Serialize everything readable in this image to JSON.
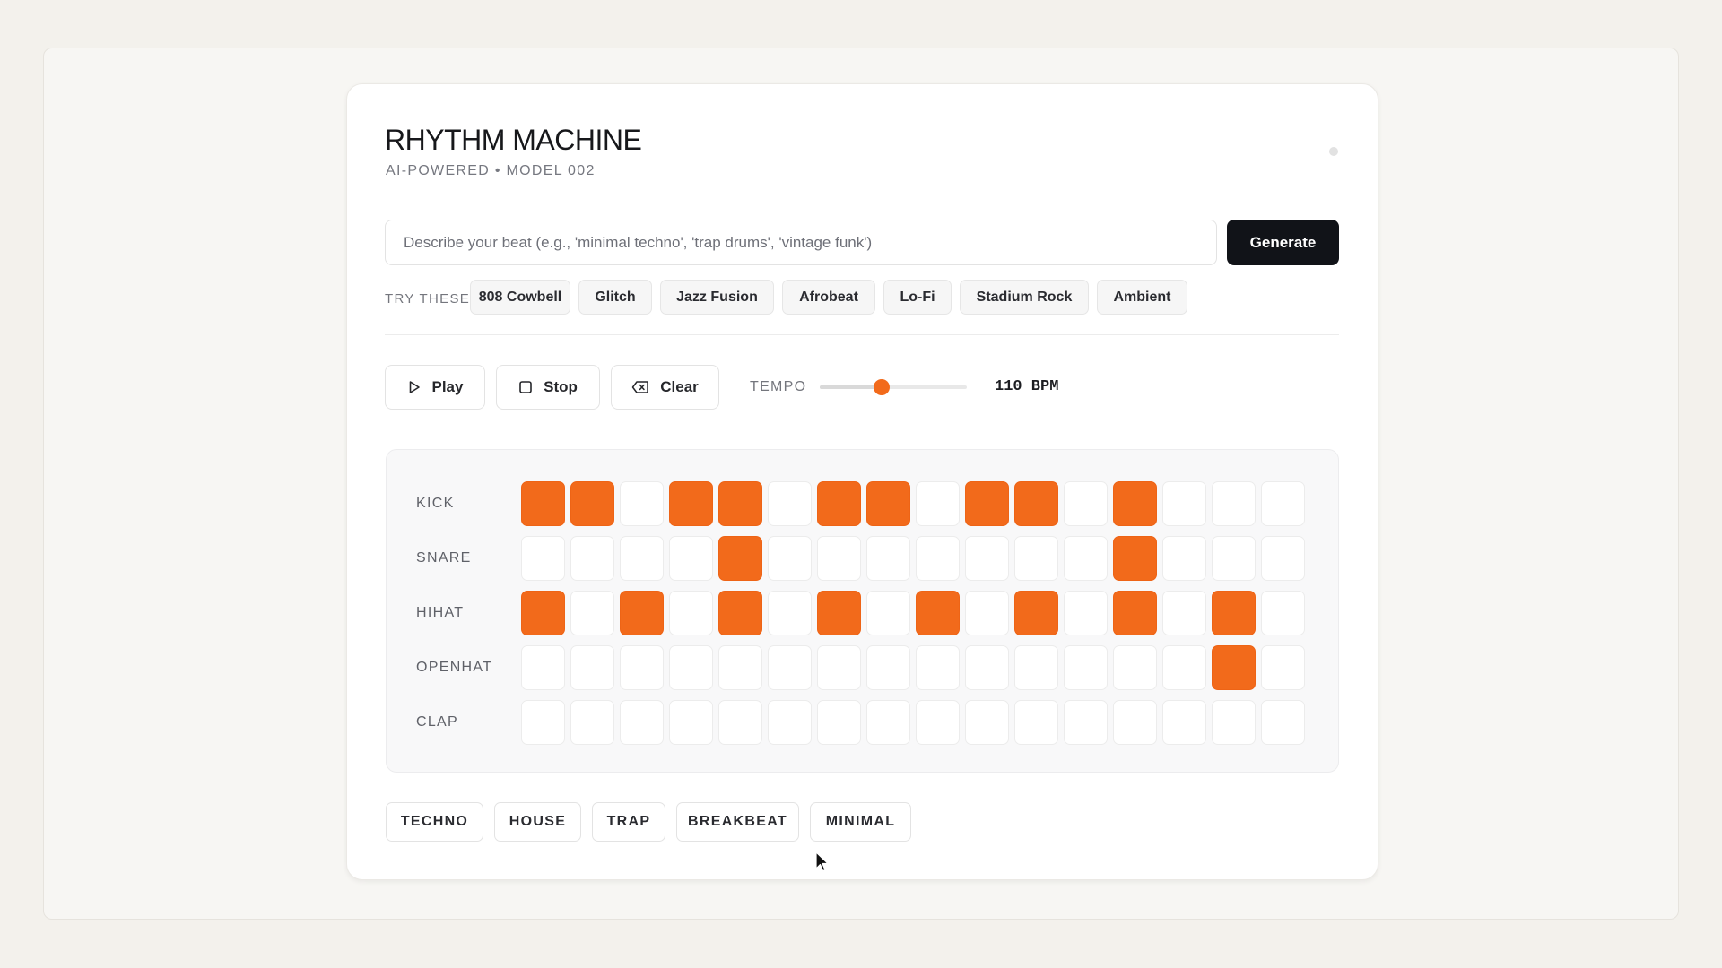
{
  "app": {
    "title": "RHYTHM MACHINE",
    "subtitle": "AI-POWERED • MODEL 002"
  },
  "prompt": {
    "placeholder": "Describe your beat (e.g., 'minimal techno', 'trap drums', 'vintage funk')",
    "value": "",
    "generate_label": "Generate"
  },
  "suggestions": {
    "label": "TRY THESE:",
    "items": [
      "808 Cowbell",
      "Glitch",
      "Jazz Fusion",
      "Afrobeat",
      "Lo-Fi",
      "Stadium Rock",
      "Ambient"
    ]
  },
  "controls": {
    "play_label": "Play",
    "stop_label": "Stop",
    "clear_label": "Clear",
    "tempo_label": "TEMPO",
    "tempo_value": "110 BPM",
    "tempo_fraction": 0.42
  },
  "sequencer": {
    "tracks": [
      {
        "name": "KICK",
        "steps": [
          1,
          1,
          0,
          1,
          1,
          0,
          1,
          1,
          0,
          1,
          1,
          0,
          1,
          0,
          0,
          0
        ]
      },
      {
        "name": "SNARE",
        "steps": [
          0,
          0,
          0,
          0,
          1,
          0,
          0,
          0,
          0,
          0,
          0,
          0,
          1,
          0,
          0,
          0
        ]
      },
      {
        "name": "HIHAT",
        "steps": [
          1,
          0,
          1,
          0,
          1,
          0,
          1,
          0,
          1,
          0,
          1,
          0,
          1,
          0,
          1,
          0
        ]
      },
      {
        "name": "OPENHAT",
        "steps": [
          0,
          0,
          0,
          0,
          0,
          0,
          0,
          0,
          0,
          0,
          0,
          0,
          0,
          0,
          1,
          0
        ]
      },
      {
        "name": "CLAP",
        "steps": [
          0,
          0,
          0,
          0,
          0,
          0,
          0,
          0,
          0,
          0,
          0,
          0,
          0,
          0,
          0,
          0
        ]
      }
    ]
  },
  "presets": [
    "TECHNO",
    "HOUSE",
    "TRAP",
    "BREAKBEAT",
    "MINIMAL"
  ],
  "colors": {
    "accent": "#f26a1b",
    "primary_button": "#111318"
  },
  "icons": {
    "play": "play-icon",
    "stop": "stop-icon",
    "clear": "backspace-icon"
  }
}
